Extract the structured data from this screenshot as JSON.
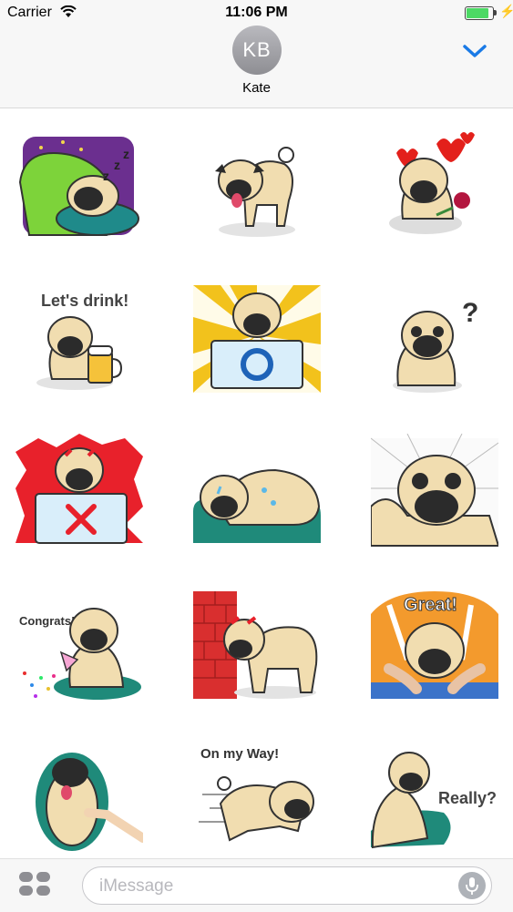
{
  "status_bar": {
    "carrier": "Carrier",
    "time": "11:06 PM",
    "battery_level": 0.85
  },
  "header": {
    "avatar_initials": "KB",
    "contact_name": "Kate"
  },
  "stickers": [
    {
      "id": "sleeping"
    },
    {
      "id": "standing"
    },
    {
      "id": "love-rose"
    },
    {
      "id": "lets-drink",
      "caption": "Let's drink!"
    },
    {
      "id": "ok-sign"
    },
    {
      "id": "question",
      "caption": "?"
    },
    {
      "id": "no-sign"
    },
    {
      "id": "crying"
    },
    {
      "id": "shocked"
    },
    {
      "id": "congrats",
      "caption": "Congrats!"
    },
    {
      "id": "wall"
    },
    {
      "id": "great",
      "caption": "Great!"
    },
    {
      "id": "belly-rub"
    },
    {
      "id": "on-my-way",
      "caption": "On my Way!"
    },
    {
      "id": "really",
      "caption": "Really?"
    }
  ],
  "compose": {
    "placeholder": "iMessage"
  },
  "icons": {
    "wifi": "wifi-icon",
    "battery": "battery-icon",
    "chevron": "chevron-down-icon",
    "apps": "apps-icon",
    "mic": "microphone-icon"
  },
  "colors": {
    "accent": "#1a7ae6",
    "battery_green": "#4cd964"
  }
}
